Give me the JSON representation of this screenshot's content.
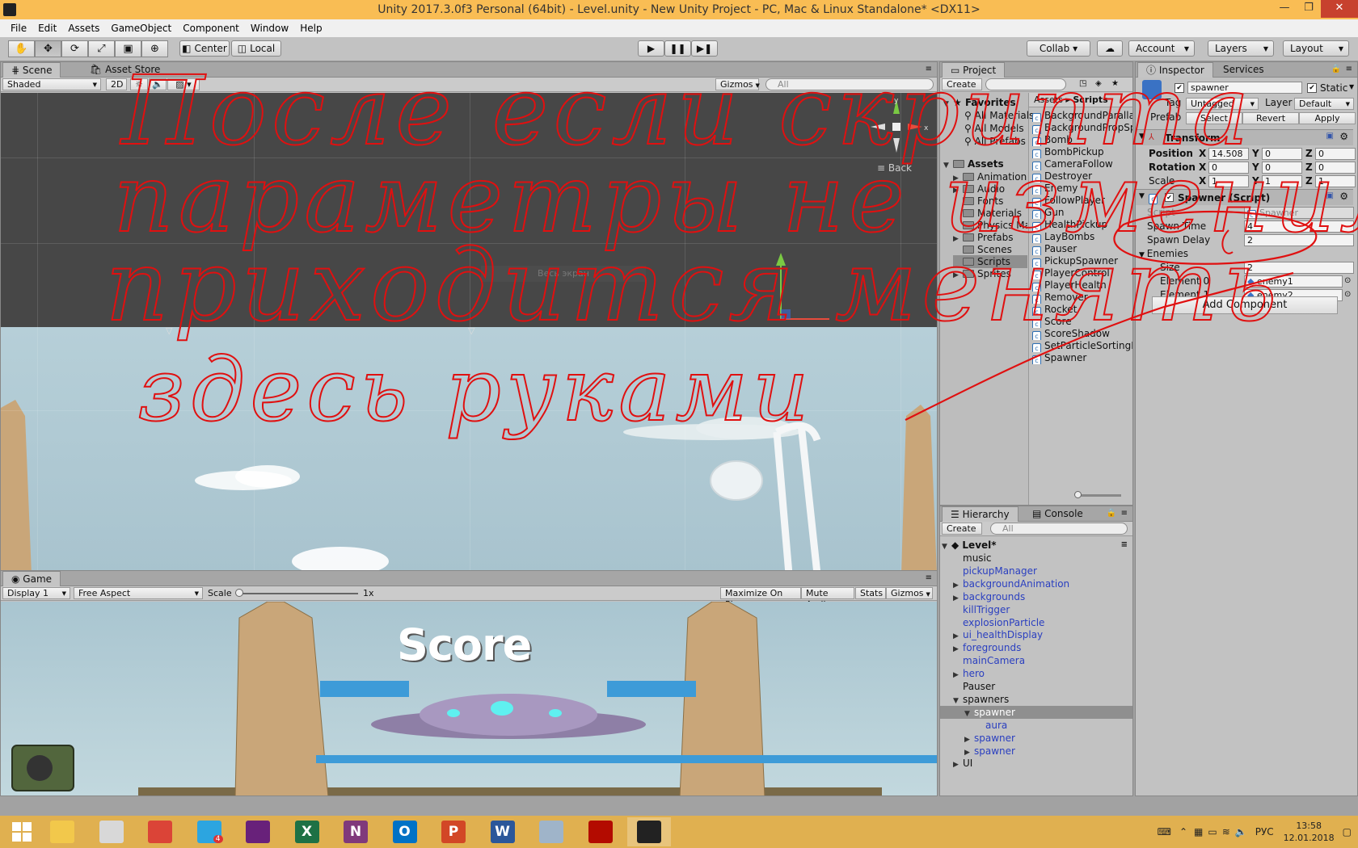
{
  "window": {
    "title": "Unity 2017.3.0f3 Personal (64bit) - Level.unity - New Unity Project - PC, Mac & Linux Standalone* <DX11>",
    "controls": [
      "—",
      "❐",
      "✕"
    ]
  },
  "menu": [
    "File",
    "Edit",
    "Assets",
    "GameObject",
    "Component",
    "Window",
    "Help"
  ],
  "toolbar": {
    "tools": [
      "hand-tool",
      "move-tool",
      "rotate-tool",
      "scale-tool",
      "rect-tool",
      "transform-tool"
    ],
    "pivot": "Center",
    "space": "Local",
    "collab": "Collab ▾",
    "account": "Account",
    "layers": "Layers",
    "layout": "Layout"
  },
  "scene": {
    "tabs": [
      "Scene",
      "Asset Store"
    ],
    "shading": "Shaded",
    "mode2d": "2D",
    "gizmos": "Gizmos",
    "search_placeholder": "All",
    "back_label": "Back",
    "fullscreen_hint": "Весь экран"
  },
  "game": {
    "tab": "Game",
    "display": "Display 1",
    "aspect": "Free Aspect",
    "scale_label": "Scale",
    "scale_value": "1x",
    "buttons": [
      "Maximize On Play",
      "Mute Audio",
      "Stats",
      "Gizmos"
    ],
    "score_text": "Score"
  },
  "project": {
    "tab": "Project",
    "create": "Create",
    "favorites_label": "Favorites",
    "favorites": [
      "All Materials",
      "All Models",
      "All Prefabs"
    ],
    "assets_label": "Assets",
    "asset_folders": [
      {
        "name": "Animation",
        "expand": true
      },
      {
        "name": "Audio",
        "expand": true
      },
      {
        "name": "Fonts",
        "expand": false
      },
      {
        "name": "Materials",
        "expand": false
      },
      {
        "name": "Physics Materials",
        "expand": false
      },
      {
        "name": "Prefabs",
        "expand": true
      },
      {
        "name": "Scenes",
        "expand": false
      },
      {
        "name": "Scripts",
        "expand": false,
        "selected": true
      },
      {
        "name": "Sprites",
        "expand": true
      }
    ],
    "breadcrumb": [
      "Assets",
      "Scripts"
    ],
    "scripts": [
      "BackgroundParallax",
      "BackgroundPropSpawner",
      "Bomb",
      "BombPickup",
      "CameraFollow",
      "Destroyer",
      "Enemy",
      "FollowPlayer",
      "Gun",
      "HealthPickup",
      "LayBombs",
      "Pauser",
      "PickupSpawner",
      "PlayerControl",
      "PlayerHealth",
      "Remover",
      "Rocket",
      "Score",
      "ScoreShadow",
      "SetParticleSortingLayer",
      "Spawner"
    ]
  },
  "hierarchy": {
    "tabs": [
      "Hierarchy",
      "Console"
    ],
    "create": "Create",
    "search_placeholder": "All",
    "scene_name": "Level*",
    "items": [
      {
        "label": "music",
        "depth": 0,
        "arrow": "",
        "color": "black"
      },
      {
        "label": "pickupManager",
        "depth": 0,
        "arrow": "",
        "color": "blue"
      },
      {
        "label": "backgroundAnimation",
        "depth": 0,
        "arrow": "▶",
        "color": "blue"
      },
      {
        "label": "backgrounds",
        "depth": 0,
        "arrow": "▶",
        "color": "blue"
      },
      {
        "label": "killTrigger",
        "depth": 0,
        "arrow": "",
        "color": "blue"
      },
      {
        "label": "explosionParticle",
        "depth": 0,
        "arrow": "",
        "color": "blue"
      },
      {
        "label": "ui_healthDisplay",
        "depth": 0,
        "arrow": "▶",
        "color": "blue"
      },
      {
        "label": "foregrounds",
        "depth": 0,
        "arrow": "▶",
        "color": "blue"
      },
      {
        "label": "mainCamera",
        "depth": 0,
        "arrow": "",
        "color": "blue"
      },
      {
        "label": "hero",
        "depth": 0,
        "arrow": "▶",
        "color": "blue"
      },
      {
        "label": "Pauser",
        "depth": 0,
        "arrow": "",
        "color": "black"
      },
      {
        "label": "spawners",
        "depth": 0,
        "arrow": "▼",
        "color": "black"
      },
      {
        "label": "spawner",
        "depth": 1,
        "arrow": "▼",
        "color": "blue",
        "selected": true
      },
      {
        "label": "aura",
        "depth": 2,
        "arrow": "",
        "color": "blue"
      },
      {
        "label": "spawner",
        "depth": 1,
        "arrow": "▶",
        "color": "blue"
      },
      {
        "label": "spawner",
        "depth": 1,
        "arrow": "▶",
        "color": "blue"
      },
      {
        "label": "UI",
        "depth": 0,
        "arrow": "▶",
        "color": "black"
      }
    ]
  },
  "inspector": {
    "tabs": [
      "Inspector",
      "Services"
    ],
    "object_name": "spawner",
    "static_label": "Static",
    "tag_label": "Tag",
    "tag_value": "Untagged",
    "layer_label": "Layer",
    "layer_value": "Default",
    "prefab_label": "Prefab",
    "prefab_buttons": [
      "Select",
      "Revert",
      "Apply"
    ],
    "transform": {
      "title": "Transform",
      "rows": [
        {
          "label": "Position",
          "x": "14.508",
          "y": "0",
          "z": "0"
        },
        {
          "label": "Rotation",
          "x": "0",
          "y": "0",
          "z": "0"
        },
        {
          "label": "Scale",
          "x": "1",
          "y": "1",
          "z": "1"
        }
      ]
    },
    "spawner": {
      "title": "Spawner (Script)",
      "script_label": "Script",
      "script_value": "Spawner",
      "spawn_time_label": "Spawn Time",
      "spawn_time": "4",
      "spawn_delay_label": "Spawn Delay",
      "spawn_delay": "2",
      "enemies_label": "Enemies",
      "size_label": "Size",
      "size": "2",
      "elements": [
        {
          "label": "Element 0",
          "value": "enemy1"
        },
        {
          "label": "Element 1",
          "value": "enemy2"
        }
      ]
    },
    "add_component": "Add Component"
  },
  "taskbar": {
    "apps": [
      {
        "name": "windows-start",
        "glyph": "",
        "color": "#e0b050"
      },
      {
        "name": "file-explorer",
        "glyph": "",
        "color": "#f2c84b"
      },
      {
        "name": "paint",
        "glyph": "",
        "color": "#d8d8d8"
      },
      {
        "name": "chrome",
        "glyph": "",
        "color": "#db4437"
      },
      {
        "name": "telegram",
        "glyph": "",
        "color": "#2ca5e0"
      },
      {
        "name": "visual-studio",
        "glyph": "",
        "color": "#68217a"
      },
      {
        "name": "excel",
        "glyph": "X",
        "color": "#1e7145"
      },
      {
        "name": "onenote",
        "glyph": "N",
        "color": "#80397b"
      },
      {
        "name": "outlook",
        "glyph": "O",
        "color": "#0072c6"
      },
      {
        "name": "powerpoint",
        "glyph": "P",
        "color": "#d24726"
      },
      {
        "name": "word",
        "glyph": "W",
        "color": "#2b579a"
      },
      {
        "name": "calculator",
        "glyph": "",
        "color": "#9fb4c9"
      },
      {
        "name": "acrobat",
        "glyph": "",
        "color": "#b30b00"
      },
      {
        "name": "unity",
        "glyph": "",
        "color": "#222222"
      }
    ],
    "telegram_badge": "4",
    "language": "РУС",
    "time": "13:58",
    "date": "12.01.2018"
  },
  "annotation": {
    "color": "#e01010",
    "lines": [
      "После если скрипта",
      "параметры не изменились",
      "приходится менять",
      "здесь руками"
    ]
  }
}
